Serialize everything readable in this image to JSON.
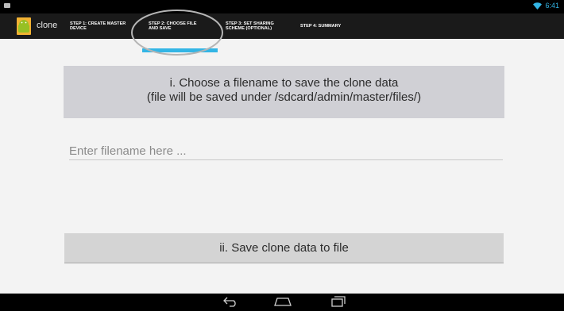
{
  "status_bar": {
    "time": "6:41"
  },
  "action_bar": {
    "app_title": "clone",
    "tabs": [
      {
        "line1": "Step 1: Create Master",
        "line2": "Device"
      },
      {
        "line1": "Step 2: Choose File",
        "line2": "and Save"
      },
      {
        "line1": "Step 3: Set Sharing",
        "line2": "Scheme (Optional)"
      },
      {
        "line1": "Step 4: Summary",
        "line2": ""
      }
    ],
    "selected_tab_index": 1
  },
  "main": {
    "instruction_line1": "i. Choose a filename to save the clone data",
    "instruction_line2": "(file will be saved under /sdcard/admin/master/files/)",
    "filename_value": "",
    "filename_placeholder": "Enter filename here ...",
    "save_button_label": "ii. Save clone data to file"
  },
  "colors": {
    "accent": "#33b5e5",
    "action_bar": "#1a1a1a",
    "background": "#f3f3f3"
  }
}
